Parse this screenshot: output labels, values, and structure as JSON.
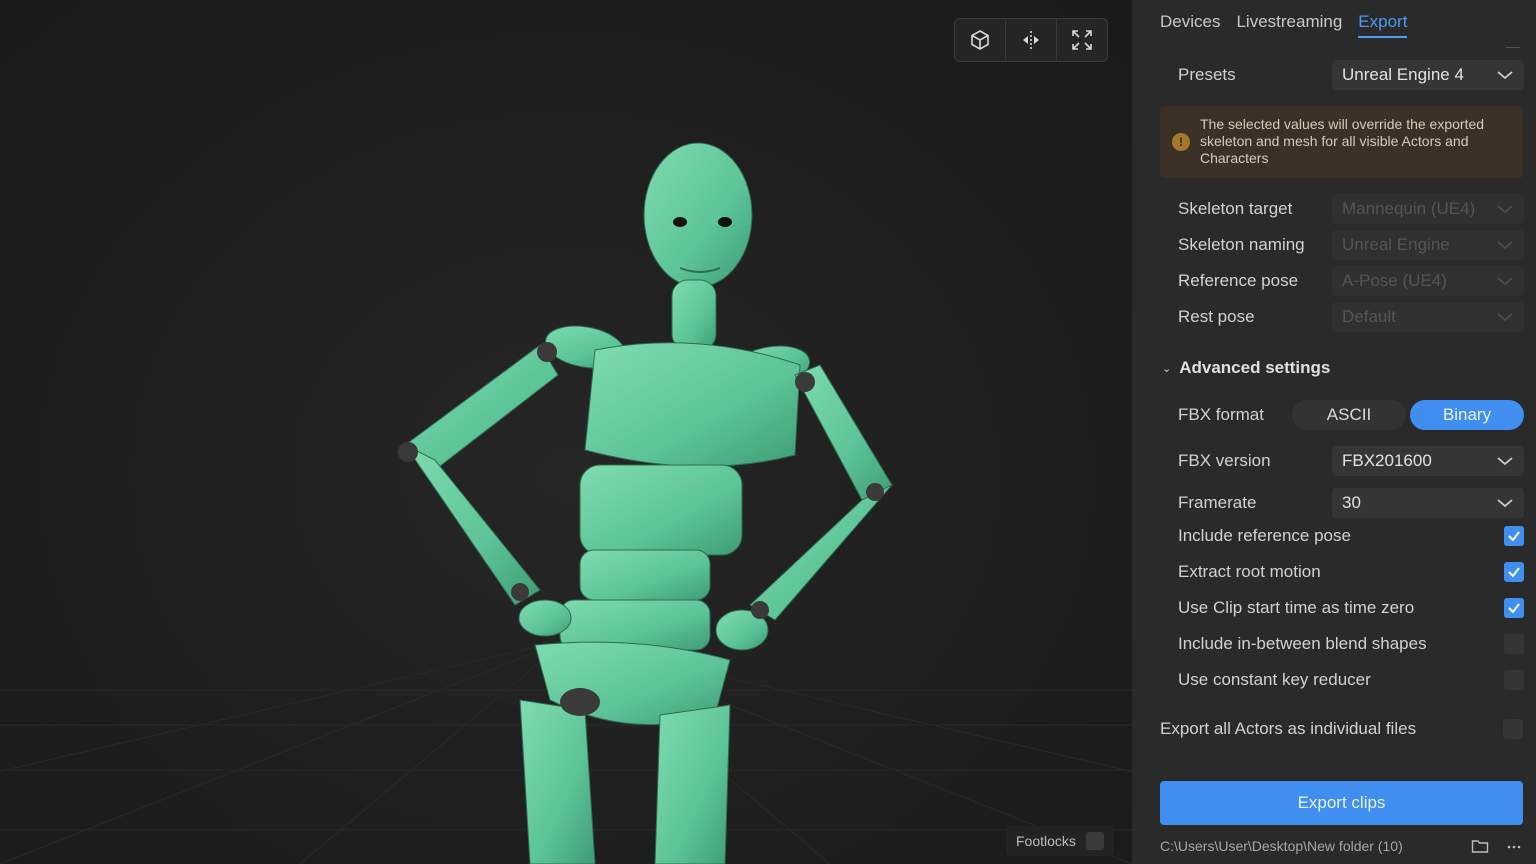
{
  "viewport": {
    "toolbar": [
      {
        "name": "cube-view-button",
        "icon": "cube-icon"
      },
      {
        "name": "mirror-button",
        "icon": "mirror-split-icon"
      },
      {
        "name": "fullscreen-button",
        "icon": "expand-icon"
      }
    ],
    "footlocks_label": "Footlocks"
  },
  "panel": {
    "tabs": [
      {
        "label": "Devices",
        "active": false
      },
      {
        "label": "Livestreaming",
        "active": false
      },
      {
        "label": "Export",
        "active": true
      }
    ],
    "presets": {
      "label": "Presets",
      "value": "Unreal Engine 4"
    },
    "warning": "The selected values will override the exported skeleton and mesh for all visible Actors and Characters",
    "skeleton_target": {
      "label": "Skeleton target",
      "value": "Mannequin (UE4)"
    },
    "skeleton_naming": {
      "label": "Skeleton naming",
      "value": "Unreal Engine"
    },
    "reference_pose": {
      "label": "Reference pose",
      "value": "A-Pose (UE4)"
    },
    "rest_pose": {
      "label": "Rest pose",
      "value": "Default"
    },
    "advanced": {
      "label": "Advanced settings"
    },
    "fbx_format": {
      "label": "FBX format",
      "options": [
        "ASCII",
        "Binary"
      ],
      "selected": "Binary"
    },
    "fbx_version": {
      "label": "FBX version",
      "value": "FBX201600"
    },
    "framerate": {
      "label": "Framerate",
      "value": "30"
    },
    "checks": [
      {
        "label": "Include reference pose",
        "checked": true
      },
      {
        "label": "Extract root motion",
        "checked": true
      },
      {
        "label": "Use Clip start time as time zero",
        "checked": true
      },
      {
        "label": "Include in-between blend shapes",
        "checked": false
      },
      {
        "label": "Use constant key reducer",
        "checked": false
      }
    ],
    "export_individual": {
      "label": "Export all Actors as individual files",
      "checked": false
    },
    "export_button": "Export clips",
    "path": "C:\\Users\\User\\Desktop\\New folder (10)"
  },
  "colors": {
    "accent": "#3f8ef0",
    "tab_active": "#4a9cf5",
    "figure": "#5fc79a"
  }
}
